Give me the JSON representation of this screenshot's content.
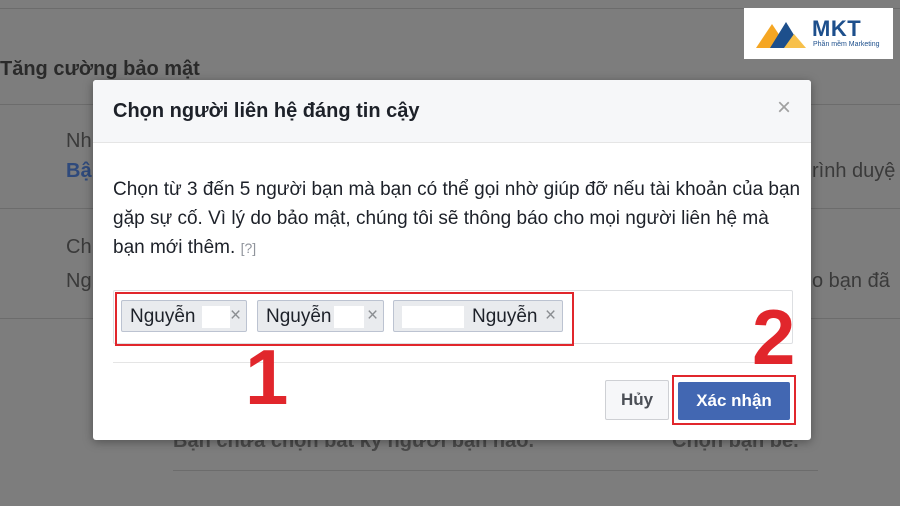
{
  "background": {
    "section_title": "Tăng cường bảo mật",
    "row1_label_partial": "Nh",
    "row1_link_partial": "Bậ",
    "row1_right_partial": "rình duyệ",
    "row2_label_partial": "Ch",
    "row2_sub_partial": "Ng",
    "row2_right_partial": "o bạn đã",
    "bottom_text": "Bạn chưa chọn bất kỳ người bạn nào.",
    "bottom_right": "Chọn bạn bè."
  },
  "logo": {
    "name": "MKT",
    "subtitle": "Phần mềm Marketing"
  },
  "dialog": {
    "title": "Chọn người liên hệ đáng tin cậy",
    "close_symbol": "×",
    "description": "Chọn từ 3 đến 5 người bạn mà bạn có thể gọi nhờ giúp đỡ nếu tài khoản của bạn gặp sự cố. Vì lý do bảo mật, chúng tôi sẽ thông báo cho mọi người liên hệ mà bạn mới thêm.",
    "help_link": "[?]",
    "tokens": [
      {
        "name": "Nguyễn",
        "remove": "×"
      },
      {
        "name": "Nguyễn",
        "remove": "×"
      },
      {
        "name": "Nguyễn",
        "remove": "×"
      }
    ],
    "cancel_label": "Hủy",
    "confirm_label": "Xác nhận"
  },
  "annotations": {
    "step1": "1",
    "step2": "2"
  },
  "colors": {
    "accent": "#4267b2",
    "annotation_red": "#e1262c"
  }
}
